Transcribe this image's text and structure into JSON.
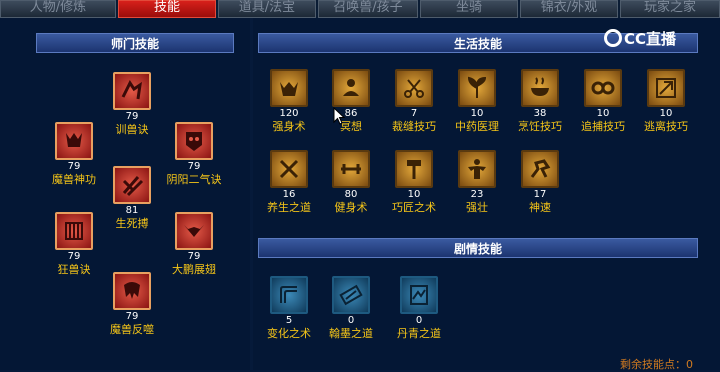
{
  "tabs": [
    "人物/修炼",
    "技能",
    "道具/法宝",
    "召唤兽/孩子",
    "坐骑",
    "锦衣/外观",
    "玩家之家"
  ],
  "active_tab": "技能",
  "logo_text": "CC直播",
  "sections": {
    "school": "师门技能",
    "life": "生活技能",
    "plot": "剧情技能"
  },
  "school_skills": [
    {
      "name": "训兽诀",
      "level": "79",
      "icon": "whip-icon"
    },
    {
      "name": "魔兽神功",
      "level": "79",
      "icon": "beast-head-icon"
    },
    {
      "name": "阴阳二气诀",
      "level": "79",
      "icon": "mask-icon"
    },
    {
      "name": "生死搏",
      "level": "81",
      "icon": "claw-icon"
    },
    {
      "name": "狂兽诀",
      "level": "79",
      "icon": "cage-icon"
    },
    {
      "name": "大鹏展翅",
      "level": "79",
      "icon": "wings-icon"
    },
    {
      "name": "魔兽反噬",
      "level": "79",
      "icon": "fang-icon"
    }
  ],
  "life_skills": [
    {
      "name": "强身术",
      "level": "120",
      "icon": "strength-icon"
    },
    {
      "name": "冥想",
      "level": "86",
      "icon": "meditation-icon"
    },
    {
      "name": "裁缝技巧",
      "level": "7",
      "icon": "scissors-icon"
    },
    {
      "name": "中药医理",
      "level": "10",
      "icon": "herb-icon"
    },
    {
      "name": "烹饪技巧",
      "level": "38",
      "icon": "cooking-icon"
    },
    {
      "name": "追捕技巧",
      "level": "10",
      "icon": "chase-icon"
    },
    {
      "name": "逃离技巧",
      "level": "10",
      "icon": "escape-icon"
    },
    {
      "name": "养生之道",
      "level": "16",
      "icon": "health-icon"
    },
    {
      "name": "健身术",
      "level": "80",
      "icon": "fitness-icon"
    },
    {
      "name": "巧匠之术",
      "level": "10",
      "icon": "craft-icon"
    },
    {
      "name": "强壮",
      "level": "23",
      "icon": "muscle-icon"
    },
    {
      "name": "神速",
      "level": "17",
      "icon": "speed-icon"
    }
  ],
  "plot_skills": [
    {
      "name": "变化之术",
      "level": "5",
      "icon": "transform-icon"
    },
    {
      "name": "翰墨之道",
      "level": "0",
      "icon": "ink-icon"
    },
    {
      "name": "丹青之道",
      "level": "0",
      "icon": "painting-icon"
    }
  ],
  "remaining_points": "剩余技能点：0",
  "colors": {
    "red_icon": "#c4362a",
    "gold_icon": "#d9962e",
    "blue_icon": "#2a7aa8",
    "label": "#f5c518"
  }
}
